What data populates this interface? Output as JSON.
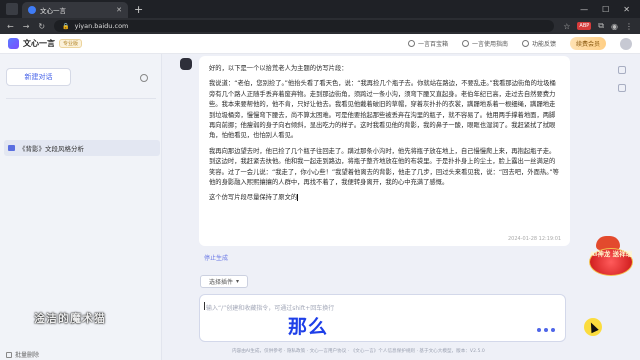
{
  "browser": {
    "tab_title": "文心一言",
    "url": "yiyan.baidu.com",
    "new_tab": "+",
    "ext_badge": "ABP"
  },
  "header": {
    "logo_text": "文心一言",
    "pro_badge": "专业版",
    "links": [
      "一言百宝箱",
      "一言使用指南",
      "功能反馈"
    ],
    "vip_label": "续费会员"
  },
  "sidebar": {
    "new_chat_label": "新建对话",
    "history": [
      {
        "label": "《背影》文段风格分析"
      }
    ],
    "batch_delete": "批量删除",
    "watermark": "淦洁的魔术猫"
  },
  "answer": {
    "paragraphs": [
      "好的，以下是一个以拾荒老人为主题的仿写片段：",
      "我说道：“老伯，您别捡了。”他抬头看了看天色，说：“我再捡几个瓶子去。你就站在路边，不要乱走。”我看那边街角的垃圾桶旁有几个路人正随手丢弃着废弃物。走到那边街角，须跨过一条小沟，须弯下腰又直起身。老伯年纪已高，走过去自然要费力些。我本来要帮他的，他不肯，只好让他去。我看见他戴着破旧的草帽，穿着灰扑扑的衣裳，蹒跚地系着一根细绳，蹒跚地走到垃圾桶旁，慢慢弯下腰去，尚不算太困难。可是他要拾起那些被丢弃在沟里的瓶子，就不容易了。他用两手撑着地面，两脚再向前挪；他瘦弱的身子向右倾斜，显出吃力的样子。这时我看见他的背影，我的鼻子一酸，眼眶也湿润了。我赶紧拭了拭眼角，怕他看见，也怕别人看见。",
      "我再向那边望去时，他已捡了几个瓶子往回走了。蹒过那条小沟时，他先将瓶子放在地上，自己慢慢爬上来，再抱起瓶子走。到这边时，我赶紧去扶他。他和我一起走到路边，将瓶子整齐地放在他的布袋里。于是扑扑身上的尘土，脸上露出一丝满足的笑容。过了一会儿说：“我走了，你小心些！”我望着他离去的背影，他走了几步，回过头来看见我，说：“回去吧，外面热。”等他的身影融入熙熙攘攘的人群中，再找不着了，我便转身离开，我的心中充满了感慨。",
      "这个仿写片段尽量保持了原文的"
    ],
    "timestamp": "2024-01-28 12:19:01",
    "stop_label": "停止生成"
  },
  "composer": {
    "plugin_label": "选择插件",
    "placeholder": "输入“/”创建和收藏指令，可通过shift+回车换行"
  },
  "overlay": {
    "subtitle": "那么",
    "promo_text": "AI神龙 送祥瑞"
  },
  "footer": {
    "note": "内容由AI生成，仅供参考 · 隐私政策 · 文心一言用户协议 · 《文心一言》个人信息保护规则 · 基于文心大模型，版本：V2.5.0"
  },
  "colors": {
    "accent": "#4562e9",
    "subtitle_blue": "#1e3fe8",
    "vip_gold": "#ffcf86",
    "promo_red": "#c91414"
  },
  "icons": [
    "search-icon",
    "history-doc-icon",
    "send-icon",
    "plugin-icon",
    "gift-icon"
  ]
}
